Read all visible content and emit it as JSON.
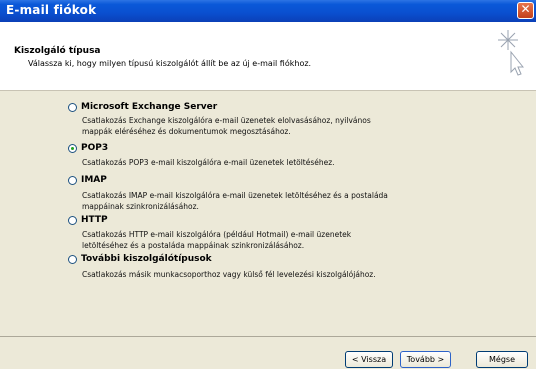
{
  "window": {
    "title": "E-mail fiókok"
  },
  "header": {
    "title": "Kiszolgáló típusa",
    "subtitle": "Válassza ki, hogy milyen típusú kiszolgálót állít be az új e-mail fiókhoz."
  },
  "options": [
    {
      "label": "Microsoft Exchange Server",
      "checked": false,
      "desc1": "Csatlakozás Exchange kiszolgálóra e-mail üzenetek elolvasásához, nyilvános",
      "desc2": "mappák eléréséhez és dokumentumok megosztásához."
    },
    {
      "label": "POP3",
      "checked": true,
      "desc1": "Csatlakozás POP3 e-mail kiszolgálóra e-mail üzenetek letöltéséhez.",
      "desc2": ""
    },
    {
      "label": "IMAP",
      "checked": false,
      "desc1": "Csatlakozás IMAP e-mail kiszolgálóra e-mail üzenetek letöltéséhez és a postaláda",
      "desc2": "mappáinak szinkronizálásához."
    },
    {
      "label": "HTTP",
      "checked": false,
      "desc1": "Csatlakozás HTTP e-mail kiszolgálóra (például Hotmail) e-mail üzenetek",
      "desc2": "letöltéséhez és a postaláda mappáinak szinkronizálásához."
    },
    {
      "label": "További kiszolgálótípusok",
      "checked": false,
      "desc1": "Csatlakozás másik munkacsoporthoz vagy külső fél levelezési kiszolgálójához.",
      "desc2": ""
    }
  ],
  "buttons": {
    "back": "< Vissza",
    "next": "Tovább >",
    "cancel": "Mégse"
  },
  "icons": {
    "wizard": "wizard-wand-icon",
    "close": "close-icon"
  }
}
